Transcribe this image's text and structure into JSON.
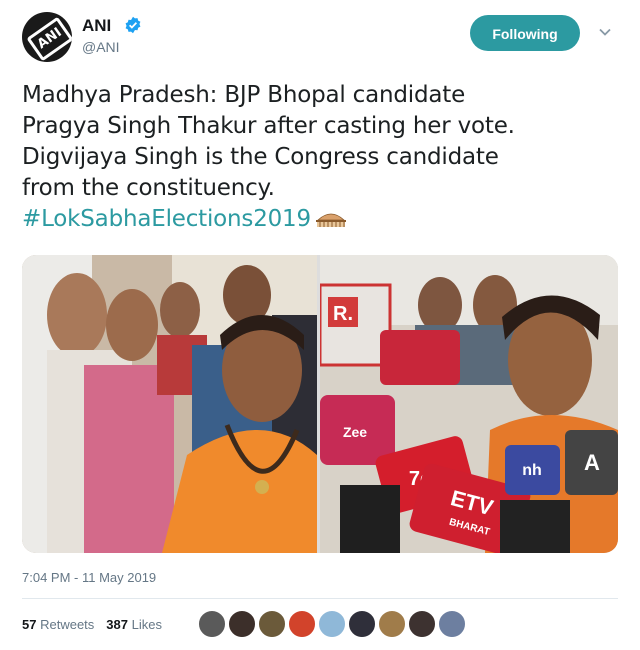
{
  "author": {
    "name": "ANI",
    "handle": "@ANI",
    "avatar_text": "ANI"
  },
  "follow_button": {
    "label": "Following"
  },
  "tweet": {
    "lines": [
      "Madhya Pradesh: BJP Bhopal candidate",
      "Pragya Singh Thakur after casting her vote.",
      "Digvijaya Singh is the Congress candidate",
      "from the constituency."
    ],
    "hashtag": "#LokSabhaElections2019"
  },
  "media": {
    "left_photo": "photo-candidate-crowd",
    "right_photo": "photo-candidate-microphones",
    "mic_labels": [
      "R.",
      "7c",
      "ETV",
      "BHARAT",
      "Zee",
      "nh",
      "A"
    ]
  },
  "timestamp": "7:04 PM - 11 May 2019",
  "stats": {
    "retweets_count": "57",
    "retweets_label": "Retweets",
    "likes_count": "387",
    "likes_label": "Likes"
  },
  "colors": {
    "accent": "#2c9aa1",
    "muted": "#657786",
    "text": "#1c2022"
  }
}
